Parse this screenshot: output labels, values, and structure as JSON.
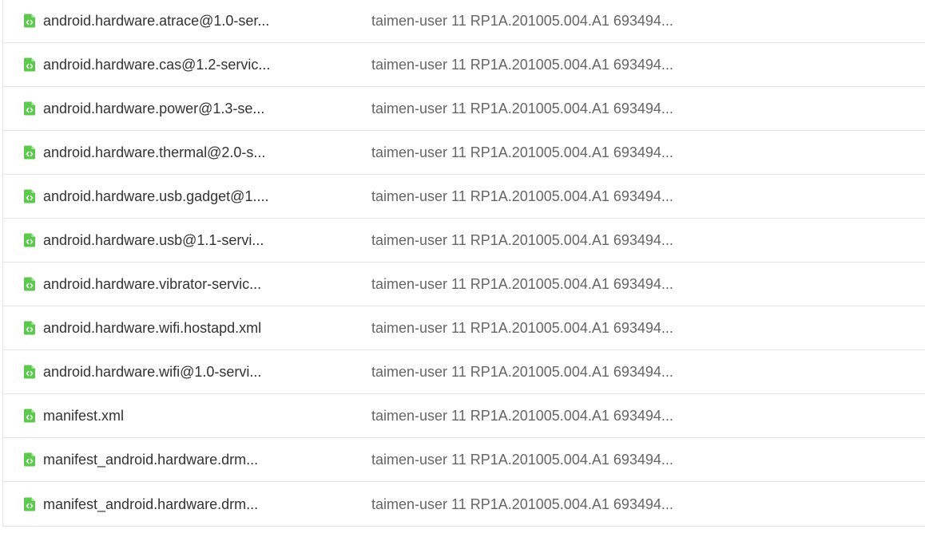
{
  "icon_color": "#5cc94e",
  "file_icon": "code-file-icon",
  "files": [
    {
      "name": "android.hardware.atrace@1.0-ser...",
      "commit": "taimen-user 11 RP1A.201005.004.A1 693494..."
    },
    {
      "name": "android.hardware.cas@1.2-servic...",
      "commit": "taimen-user 11 RP1A.201005.004.A1 693494..."
    },
    {
      "name": "android.hardware.power@1.3-se...",
      "commit": "taimen-user 11 RP1A.201005.004.A1 693494..."
    },
    {
      "name": "android.hardware.thermal@2.0-s...",
      "commit": "taimen-user 11 RP1A.201005.004.A1 693494..."
    },
    {
      "name": "android.hardware.usb.gadget@1....",
      "commit": "taimen-user 11 RP1A.201005.004.A1 693494..."
    },
    {
      "name": "android.hardware.usb@1.1-servi...",
      "commit": "taimen-user 11 RP1A.201005.004.A1 693494..."
    },
    {
      "name": "android.hardware.vibrator-servic...",
      "commit": "taimen-user 11 RP1A.201005.004.A1 693494..."
    },
    {
      "name": "android.hardware.wifi.hostapd.xml",
      "commit": "taimen-user 11 RP1A.201005.004.A1 693494..."
    },
    {
      "name": "android.hardware.wifi@1.0-servi...",
      "commit": "taimen-user 11 RP1A.201005.004.A1 693494..."
    },
    {
      "name": "manifest.xml",
      "commit": "taimen-user 11 RP1A.201005.004.A1 693494..."
    },
    {
      "name": "manifest_android.hardware.drm...",
      "commit": "taimen-user 11 RP1A.201005.004.A1 693494..."
    },
    {
      "name": "manifest_android.hardware.drm...",
      "commit": "taimen-user 11 RP1A.201005.004.A1 693494..."
    }
  ]
}
